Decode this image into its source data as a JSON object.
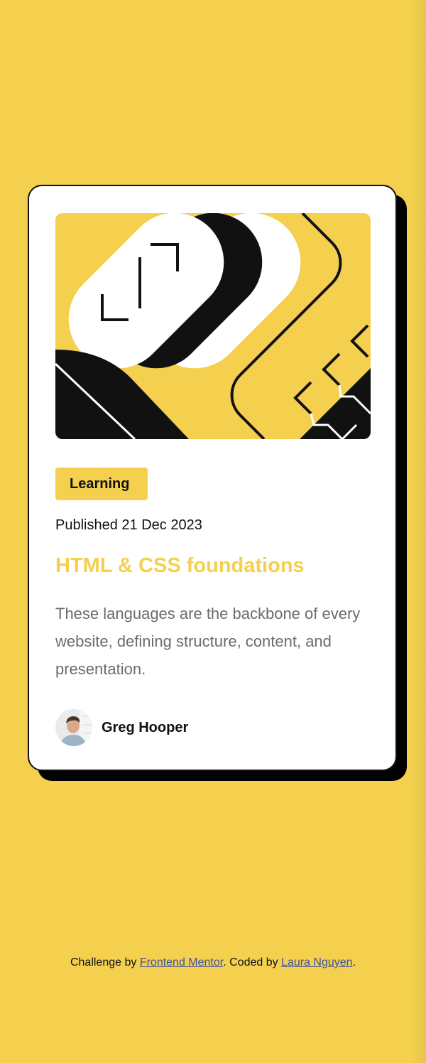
{
  "card": {
    "image_alt": "Abstract illustration",
    "tag": "Learning",
    "published": "Published 21 Dec 2023",
    "title": "HTML & CSS foundations",
    "description": "These languages are the backbone of every website, defining structure, content, and presentation.",
    "author": {
      "name": "Greg Hooper",
      "avatar": "author-avatar-photo"
    }
  },
  "footer": {
    "prefix": "Challenge by ",
    "link1": "Frontend Mentor",
    "middle": ". Coded by ",
    "link2": "Laura Nguyen",
    "suffix": "."
  },
  "colors": {
    "background": "#F4D04E",
    "card": "#FFFFFF",
    "ink": "#111111",
    "title": "#F4D04E",
    "text_muted": "#6B6B6B",
    "link": "#3E52A3"
  }
}
